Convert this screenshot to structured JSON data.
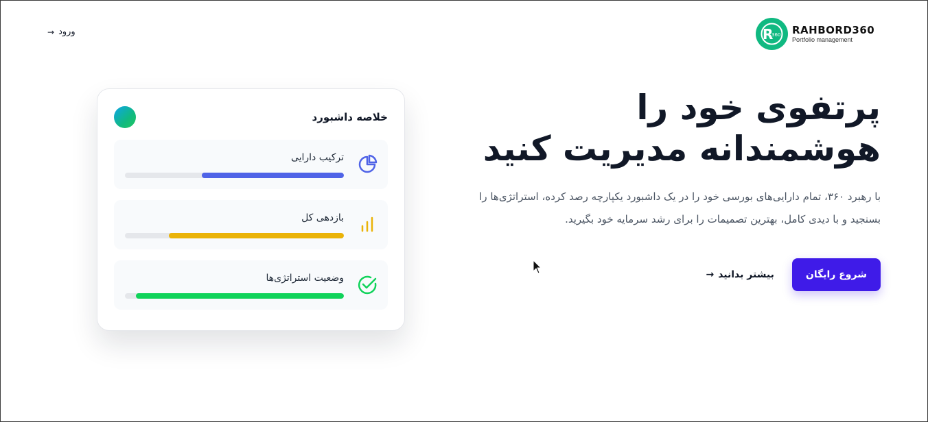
{
  "nav": {
    "login_label": "ورود",
    "login_arrow": "→"
  },
  "logo": {
    "badge_text": "360",
    "name": "RAHBORD360",
    "tagline": "Portfolio management"
  },
  "hero": {
    "title_line1": "پرتفوی خود را",
    "title_line2": "هوشمندانه مدیریت کنید",
    "description": "با رهبرد ۳۶۰، تمام دارایی‌های بورسی خود را در یک داشبورد یکپارچه رصد کرده، استراتژی‌ها را بسنجید و با دیدی کامل، بهترین تصمیمات را برای رشد سرمایه خود بگیرید.",
    "primary_button": "شروع رایگان",
    "secondary_link": "بیشتر بدانید",
    "secondary_arrow": "→"
  },
  "card": {
    "title": "خلاصه داشبورد",
    "metrics": [
      {
        "label": "ترکیب دارایی",
        "icon": "pie-chart-icon",
        "progress": 0.65,
        "color": "#4f63e7"
      },
      {
        "label": "بازدهی کل",
        "icon": "bar-chart-icon",
        "progress": 0.8,
        "color": "#eab308"
      },
      {
        "label": "وضعیت استراتژی‌ها",
        "icon": "check-circle-icon",
        "progress": 0.95,
        "color": "#10d35a"
      }
    ]
  }
}
